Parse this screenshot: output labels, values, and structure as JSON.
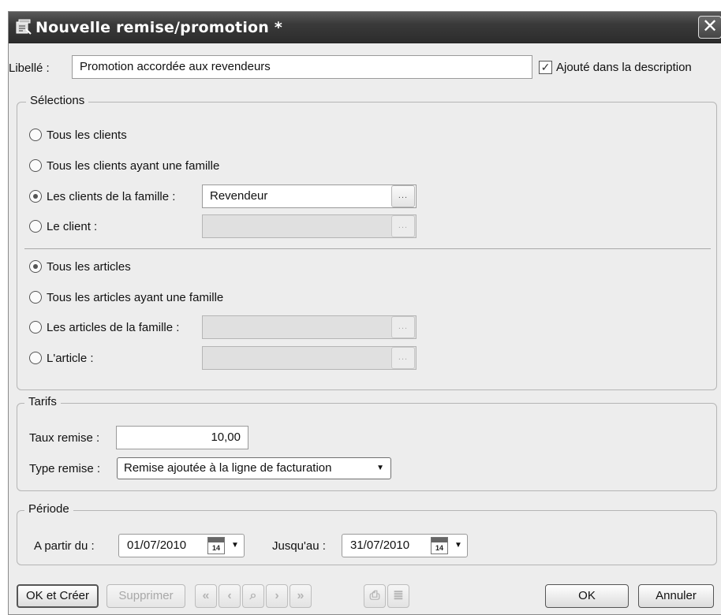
{
  "window": {
    "title": "Nouvelle remise/promotion *"
  },
  "libelle": {
    "label": "Libellé :",
    "value": "Promotion accordée aux revendeurs",
    "checkbox_label": "Ajouté dans la description",
    "checked": true
  },
  "selections": {
    "title": "Sélections",
    "clients": [
      {
        "label": "Tous les clients",
        "selected": false
      },
      {
        "label": "Tous les clients ayant une famille",
        "selected": false
      },
      {
        "label": "Les clients de la famille :",
        "selected": true
      },
      {
        "label": "Le client :",
        "selected": false
      }
    ],
    "client_family_value": "Revendeur",
    "client_value": "",
    "articles": [
      {
        "label": "Tous les articles",
        "selected": true
      },
      {
        "label": "Tous les articles ayant une famille",
        "selected": false
      },
      {
        "label": "Les articles de la famille :",
        "selected": false
      },
      {
        "label": "L'article :",
        "selected": false
      }
    ],
    "article_family_value": "",
    "article_value": "",
    "ellipsis": "..."
  },
  "tarifs": {
    "title": "Tarifs",
    "taux_label": "Taux remise :",
    "taux_value": "10,00",
    "type_label": "Type remise :",
    "type_value": "Remise ajoutée à la ligne de facturation"
  },
  "periode": {
    "title": "Période",
    "from_label": "A partir du :",
    "from_value": "01/07/2010",
    "to_label": "Jusqu'au :",
    "to_value": "31/07/2010",
    "calendar_day": "14"
  },
  "footer": {
    "ok_create": "OK et Créer",
    "delete": "Supprimer",
    "ok": "OK",
    "cancel": "Annuler",
    "nav_glyphs": [
      "«",
      "‹",
      "⌕",
      "›",
      "»"
    ],
    "print_glyph": "⎙",
    "list_glyph": "≣"
  }
}
